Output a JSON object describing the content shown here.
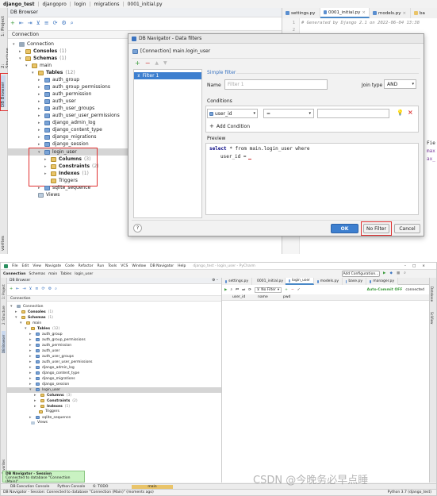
{
  "top": {
    "project": "django_test",
    "crumbs": [
      "djangopro",
      "login",
      "migrations",
      "0001_initial.py"
    ],
    "panel_title": "DB Browser",
    "connection_label": "Connection",
    "vtabs": [
      "1: Project",
      "2: Structure",
      "DB Browser"
    ],
    "bottom_vtab": "vorites",
    "tree": {
      "connection": "Connection",
      "consoles": "Consoles",
      "consoles_count": "(1)",
      "schemas": "Schemas",
      "schemas_count": "(1)",
      "main": "main",
      "tables": "Tables",
      "tables_count": "(12)",
      "table_names": [
        "auth_group",
        "auth_group_permissions",
        "auth_permission",
        "auth_user",
        "auth_user_groups",
        "auth_user_user_permissions",
        "django_admin_log",
        "django_content_type",
        "django_migrations",
        "django_session",
        "login_user"
      ],
      "columns": "Columns",
      "columns_count": "(3)",
      "constraints": "Constraints",
      "constraints_count": "(2)",
      "indexes": "Indexes",
      "indexes_count": "(1)",
      "triggers": "Triggers",
      "sqlite_sequence": "sqlite_sequence",
      "views": "Views"
    },
    "editor_tabs": [
      "settings.py",
      "0001_initial.py",
      "models.py",
      "ba"
    ],
    "code_lines": [
      {
        "num": "1",
        "text": "# Generated by Django 2.1 on 2022-06-04 13:38"
      },
      {
        "num": "2",
        "text": ""
      }
    ],
    "right_frags": [
      "Fie",
      "max",
      "ax_"
    ]
  },
  "dialog": {
    "title": "DB Navigator - Data filters",
    "header": "[Connection] main.login_user",
    "filter_item": "Filter 1",
    "simple_filter": "Simple filter",
    "name_label": "Name",
    "name_placeholder": "Filter 1",
    "join_label": "Join type",
    "join_value": "AND",
    "conditions_label": "Conditions",
    "cond_column": "user_id",
    "cond_operator": "=",
    "add_condition": "Add Condition",
    "preview_label": "Preview",
    "preview_line1_kw": "select",
    "preview_line1_rest": "* from main.login_user where",
    "preview_line2": "user_id =",
    "help": "?",
    "ok": "OK",
    "no_filter": "No Filter",
    "cancel": "Cancel"
  },
  "bottom": {
    "menu": [
      "File",
      "Edit",
      "View",
      "Navigate",
      "Code",
      "Refactor",
      "Run",
      "Tools",
      "VCS",
      "Window",
      "DB Navigator",
      "Help"
    ],
    "window_title": "django_test - login_user - PyCharm",
    "crumbs": [
      "Connection",
      "Schemas",
      "main",
      "Tables",
      "login_user"
    ],
    "add_config": "Add Configuration...",
    "panel_title": "DB Browser",
    "connection_label": "Connection",
    "tree_extra_schemas": "Schemas",
    "editor_tabs": [
      "settings.py",
      "0001_initial.py",
      "login_user",
      "models.py",
      "base.py",
      "manager.py"
    ],
    "no_filter": "No Filter",
    "auto_commit": "Auto-Commit OFF",
    "connected": "connected",
    "columns": [
      "user_id",
      "name",
      "pwd"
    ],
    "vtabs_left": [
      "1: Project",
      "2: Structure",
      "DB Browser",
      "Favorites"
    ],
    "vtabs_right": [
      "Database",
      "SciView"
    ],
    "notification_title": "DB Navigator - Session",
    "notification_body": "Connected to database \"Connection (Main)\"",
    "bottom_tabs": [
      "DB Execution Console",
      "Python Console",
      "6: TODO"
    ],
    "status_text": "DB Navigator - Session: Connected to database \"Connection (Main)\" (moments ago)",
    "status_right": "Python 3.7 (django_test)",
    "watermark": "CSDN @今晚务必早点睡",
    "main_tab": "main"
  },
  "colors": {
    "highlight_red": "#e03030",
    "select_blue": "#3d7fcf",
    "tree_sel": "#d5d5d5",
    "keyword": "#000080"
  }
}
